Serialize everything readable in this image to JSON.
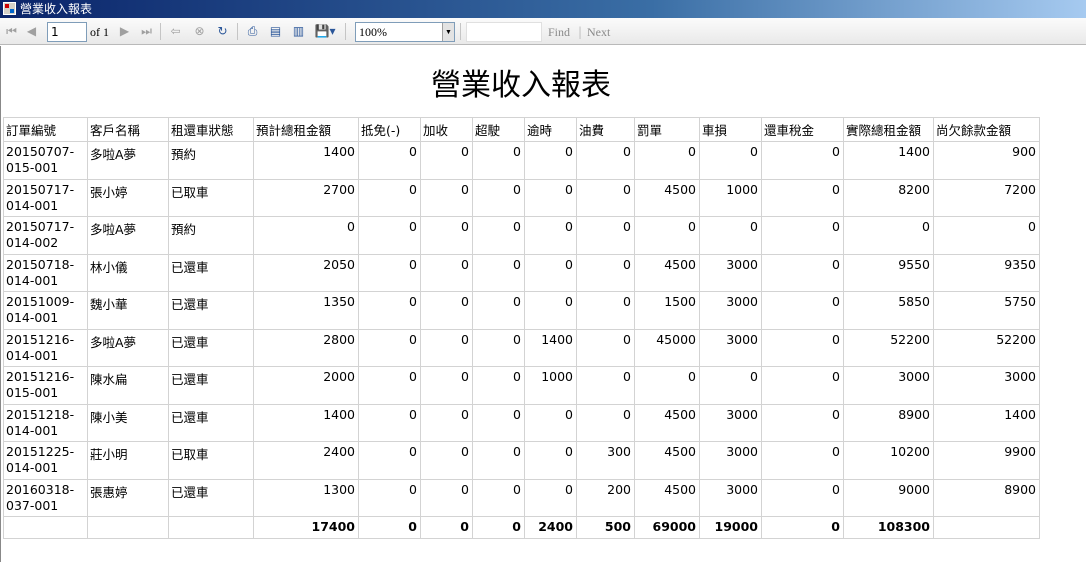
{
  "window": {
    "title": "營業收入報表"
  },
  "toolbar": {
    "page_value": "1",
    "of_label": "of 1",
    "zoom_value": "100%",
    "find_label": "Find",
    "find_separator": "|",
    "next_label": "Next",
    "icons": {
      "first": "◀",
      "prev": "◀",
      "next": "▶",
      "last": "▶",
      "back": "◆",
      "stop": "⊗",
      "refresh": "↻",
      "print": "▣",
      "layout": "▤",
      "page_setup": "▥",
      "export": "▼"
    }
  },
  "report": {
    "title": "營業收入報表",
    "columns": [
      "訂單編號",
      "客戶名稱",
      "租還車狀態",
      "預計總租金額",
      "抵免(-)",
      "加收",
      "超駛",
      "逾時",
      "油費",
      "罰單",
      "車損",
      "還車稅金",
      "實際總租金額",
      "尚欠餘款金額"
    ],
    "rows": [
      [
        "20150707-015-001",
        "多啦A夢",
        "預約",
        "1400",
        "0",
        "0",
        "0",
        "0",
        "0",
        "0",
        "0",
        "0",
        "1400",
        "900"
      ],
      [
        "20150717-014-001",
        "張小婷",
        "已取車",
        "2700",
        "0",
        "0",
        "0",
        "0",
        "0",
        "4500",
        "1000",
        "0",
        "8200",
        "7200"
      ],
      [
        "20150717-014-002",
        "多啦A夢",
        "預約",
        "0",
        "0",
        "0",
        "0",
        "0",
        "0",
        "0",
        "0",
        "0",
        "0",
        "0"
      ],
      [
        "20150718-014-001",
        "林小儀",
        "已還車",
        "2050",
        "0",
        "0",
        "0",
        "0",
        "0",
        "4500",
        "3000",
        "0",
        "9550",
        "9350"
      ],
      [
        "20151009-014-001",
        "魏小華",
        "已還車",
        "1350",
        "0",
        "0",
        "0",
        "0",
        "0",
        "1500",
        "3000",
        "0",
        "5850",
        "5750"
      ],
      [
        "20151216-014-001",
        "多啦A夢",
        "已還車",
        "2800",
        "0",
        "0",
        "0",
        "1400",
        "0",
        "45000",
        "3000",
        "0",
        "52200",
        "52200"
      ],
      [
        "20151216-015-001",
        "陳水扁",
        "已還車",
        "2000",
        "0",
        "0",
        "0",
        "1000",
        "0",
        "0",
        "0",
        "0",
        "3000",
        "3000"
      ],
      [
        "20151218-014-001",
        "陳小美",
        "已還車",
        "1400",
        "0",
        "0",
        "0",
        "0",
        "0",
        "4500",
        "3000",
        "0",
        "8900",
        "1400"
      ],
      [
        "20151225-014-001",
        "莊小明",
        "已取車",
        "2400",
        "0",
        "0",
        "0",
        "0",
        "300",
        "4500",
        "3000",
        "0",
        "10200",
        "9900"
      ],
      [
        "20160318-037-001",
        "張惠婷",
        "已還車",
        "1300",
        "0",
        "0",
        "0",
        "0",
        "200",
        "4500",
        "3000",
        "0",
        "9000",
        "8900"
      ]
    ],
    "totals": [
      "",
      "",
      "",
      "17400",
      "0",
      "0",
      "0",
      "2400",
      "500",
      "69000",
      "19000",
      "0",
      "108300",
      ""
    ]
  }
}
